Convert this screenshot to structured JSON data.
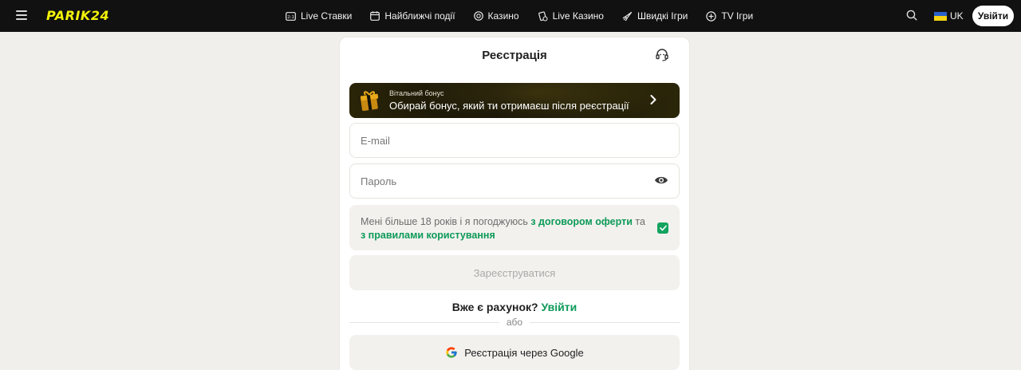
{
  "header": {
    "logo": "PARIK24",
    "nav": [
      {
        "label": "Live Ставки",
        "icon": "scoreboard-icon"
      },
      {
        "label": "Найближчі події",
        "icon": "calendar-icon"
      },
      {
        "label": "Казино",
        "icon": "casino-chip-icon"
      },
      {
        "label": "Live Казино",
        "icon": "live-casino-icon"
      },
      {
        "label": "Швидкі Ігри",
        "icon": "rocket-icon"
      },
      {
        "label": "TV Ігри",
        "icon": "tv-games-icon"
      }
    ],
    "lang": "UK",
    "login_label": "Увійти"
  },
  "card": {
    "title": "Реєстрація",
    "bonus": {
      "subtitle": "Вітальний бонус",
      "title": "Обирай бонус, який ти отримаєш після реєстрації"
    },
    "email_placeholder": "E-mail",
    "password_placeholder": "Пароль",
    "consent": {
      "prefix": "Мені більше 18 років і я погоджуюсь ",
      "link1": "з договором оферти",
      "middle": " та ",
      "link2": "з правилами користування",
      "checked": true
    },
    "submit_label": "Зареєструватися",
    "have_account": "Вже є рахунок?",
    "have_account_link": "Увійти",
    "or": "або",
    "google_label": "Реєстрація через Google"
  },
  "colors": {
    "header_bg": "#111111",
    "logo": "#f2f20a",
    "accent_green": "#0c9a58",
    "page_bg": "#f1efeb"
  }
}
